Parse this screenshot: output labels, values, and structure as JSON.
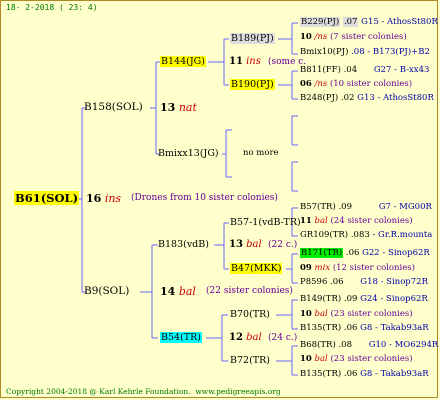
{
  "header": {
    "date": "18- 2-2018 ( 23: 4)"
  },
  "footer": {
    "copyright": "Copyright 2004-2018 @ Karl Kehrle Foundation.",
    "url": "www.pedigreeapis.org"
  },
  "colors": {
    "line": "#6666ff",
    "highlight_yellow": "#ffff00",
    "highlight_green": "#00ee00",
    "highlight_cyan": "#00ffff",
    "red": "#cc0000",
    "blue": "#0000aa"
  },
  "root": {
    "name": "B61(SOL)",
    "gen_num": "16",
    "gen_code": "ins",
    "note": "(Drones from 10 sister colonies)"
  },
  "l1": {
    "top": {
      "name": "B158(SOL)",
      "gen_num": "13",
      "gen_code": "nat"
    },
    "bottom": {
      "name": "B9(SOL)",
      "gen_num": "14",
      "gen_code": "bal",
      "note": "(22 sister colonies)"
    }
  },
  "l2": {
    "b144": {
      "name": "B144(JG)",
      "gen_num": "11",
      "gen_code": "ins",
      "note": "(some c."
    },
    "bmixx13": {
      "name": "Bmixx13(JG)",
      "note": "no more"
    },
    "b183": {
      "name": "B183(vdB)",
      "gen_num": "13",
      "gen_code": "bal",
      "note": "(22 c.)"
    },
    "b54": {
      "name": "B54(TR)",
      "gen_num": "12",
      "gen_code": "bal",
      "note": "(24 c.)"
    }
  },
  "l3": {
    "b189": {
      "name": "B189(PJ)"
    },
    "b190": {
      "name": "B190(PJ)"
    },
    "b57": {
      "name": "B57-1(vdB-TR)"
    },
    "b47": {
      "name": "B47(MKK)"
    },
    "b70": {
      "name": "B70(TR)"
    },
    "b72": {
      "name": "B72(TR)"
    }
  },
  "l4": {
    "r1": {
      "name": "B229(PJ)",
      "year": ".07",
      "breeder": "G15 - AthosSt80R"
    },
    "r2": {
      "gen_num": "10",
      "gen_code": "/ns",
      "note": "(7 sister colonies)"
    },
    "r3": {
      "name": "Bmix10(PJ)",
      "year": ".08",
      "breeder": "- B173(PJ)+B2"
    },
    "r4": {
      "name": "B811(FF)",
      "year": ".04",
      "breeder": "G27 - B-xx43"
    },
    "r5": {
      "gen_num": "06",
      "gen_code": "/ns",
      "note": "(10 sister colonies)"
    },
    "r6": {
      "name": "B248(PJ)",
      "year": ".02",
      "breeder": "G13 - AthosSt80R"
    },
    "r7": {
      "name": "B57(TR)",
      "year": ".09",
      "breeder": "G7 - MG00R"
    },
    "r8": {
      "gen_num": "11",
      "gen_code": "bal",
      "note": "(24 sister colonies)"
    },
    "r9": {
      "name": "GR109(TR)",
      "year": ".083",
      "breeder": "- Gr.R.mounta"
    },
    "r10": {
      "name": "B171(TR)",
      "year": ".06",
      "breeder": "G22 - Sinop62R"
    },
    "r11": {
      "gen_num": "09",
      "gen_code": "mix",
      "note": "(12 sister colonies)"
    },
    "r12": {
      "name": "P8596",
      "year": ".06",
      "breeder": "G18 - Sinop72R"
    },
    "r13": {
      "name": "B149(TR)",
      "year": ".09",
      "breeder": "G24 - Sinop62R"
    },
    "r14": {
      "gen_num": "10",
      "gen_code": "bal",
      "note": "(23 sister colonies)"
    },
    "r15": {
      "name": "B135(TR)",
      "year": ".06",
      "breeder": "G8 - Takab93aR"
    },
    "r16": {
      "name": "B68(TR)",
      "year": ".08",
      "breeder": "G10 - MO6294R"
    },
    "r17": {
      "gen_num": "10",
      "gen_code": "bal",
      "note": "(23 sister colonies)"
    },
    "r18": {
      "name": "B135(TR)",
      "year": ".06",
      "breeder": "G8 - Takab93aR"
    }
  }
}
